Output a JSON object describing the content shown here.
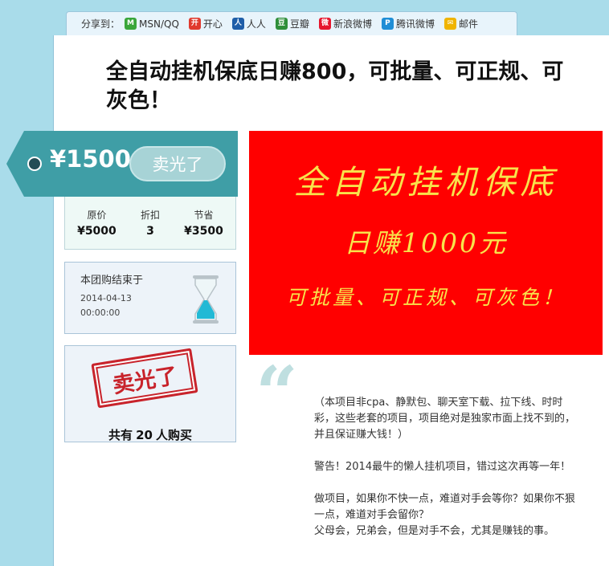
{
  "share": {
    "label": "分享到：",
    "items": [
      {
        "label": "MSN/QQ",
        "icon": "msn-icon",
        "color": "#3aa63a",
        "glyph": "M"
      },
      {
        "label": "开心",
        "icon": "kaixin-icon",
        "color": "#e03a2e",
        "glyph": "开"
      },
      {
        "label": "人人",
        "icon": "renren-icon",
        "color": "#1f5ea8",
        "glyph": "人"
      },
      {
        "label": "豆瓣",
        "icon": "douban-icon",
        "color": "#2f8f3a",
        "glyph": "豆"
      },
      {
        "label": "新浪微博",
        "icon": "weibo-icon",
        "color": "#e6162d",
        "glyph": "微"
      },
      {
        "label": "腾讯微博",
        "icon": "tencent-weibo-icon",
        "color": "#1f8ed6",
        "glyph": "P"
      },
      {
        "label": "邮件",
        "icon": "mail-icon",
        "color": "#f0b400",
        "glyph": "✉"
      }
    ]
  },
  "title": "全自动挂机保底日赚800，可批量、可正规、可灰色！",
  "price": {
    "value": "¥1500",
    "button_label": "卖光了",
    "accent": "#3f9ea6"
  },
  "stats": [
    {
      "label": "原价",
      "value": "¥5000"
    },
    {
      "label": "折扣",
      "value": "3"
    },
    {
      "label": "节省",
      "value": "¥3500"
    }
  ],
  "timer": {
    "label": "本团购结束于",
    "date": "2014-04-13",
    "time": "00:00:00"
  },
  "buyers": {
    "stamp_text": "卖光了",
    "prefix": "共有",
    "count": "20",
    "suffix": "人购买"
  },
  "banner": {
    "line1": "全自动挂机保底",
    "line2": "日赚1000元",
    "line3": "可批量、可正规、可灰色！",
    "bg_color": "#ff0000",
    "text_color": "#f8e34b"
  },
  "quote_mark": "“",
  "description": {
    "p1": "（本项目非cpa、静默包、聊天室下载、拉下线、时时彩，这些老套的项目，项目绝对是独家市面上找不到的，并且保证赚大钱！）",
    "p2": "警告！2014最牛的懒人挂机项目，错过这次再等一年！",
    "p3": "做项目，如果你不快一点，难道对手会等你？如果你不狠一点，难道对手会留你？",
    "p4": "父母会，兄弟会，但是对手不会，尤其是赚钱的事。"
  }
}
